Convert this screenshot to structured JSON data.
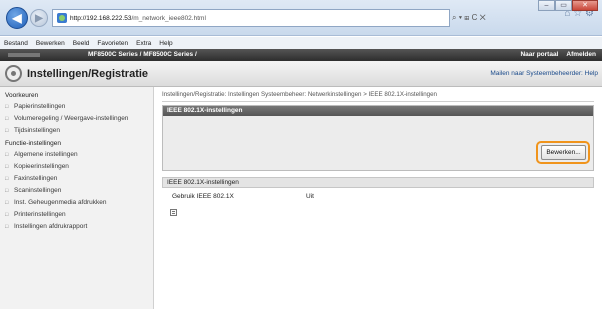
{
  "browser": {
    "url_host": "http://192.168.222.53",
    "url_path": "/m_network_ieee802.html",
    "addr_tools": "⌕ ▾ ⊞ C ✕",
    "right_icons": "⌂ ☆ ⚙",
    "window_buttons": [
      "–",
      "▭",
      "✕"
    ],
    "menu": [
      "Bestand",
      "Bewerken",
      "Beeld",
      "Favorieten",
      "Extra",
      "Help"
    ]
  },
  "device_bar": {
    "name": "MF8500C Series / MF8500C Series /",
    "links": [
      "Naar portaal",
      "Afmelden"
    ]
  },
  "page_header": {
    "title": "Instellingen/Registratie",
    "system_link": "Mailen naar Systeembeheerder: Help"
  },
  "sidebar": {
    "group1": "Voorkeuren",
    "group1_items": [
      "Papierinstellingen",
      "Volumeregeling / Weergave-instellingen",
      "Tijdsinstellingen"
    ],
    "group2": "Functie-instellingen",
    "group2_items": [
      "Algemene instellingen",
      "Kopieerinstellingen",
      "Faxinstellingen",
      "Scaninstellingen",
      "Inst. Geheugenmedia afdrukken",
      "Printerinstellingen",
      "Instellingen afdrukrapport"
    ]
  },
  "main": {
    "breadcrumb": "Instellingen/Registratie: Instellingen Systeembeheer: Netwerkinstellingen > IEEE 802.1X-instellingen",
    "section1_title": "IEEE 802.1X-instellingen",
    "edit_button": "Bewerken...",
    "section2_title": "IEEE 802.1X-instellingen",
    "row_label": "Gebruik IEEE 802.1X",
    "row_value": "Uit"
  },
  "colors": {
    "highlight_ring": "#f0941c",
    "dark_bar": "#2d2d2d",
    "link": "#1a4a8a"
  },
  "icons": {
    "back": "back-arrow-icon",
    "forward": "forward-arrow-icon",
    "page": "page-favicon-icon",
    "gear": "gear-icon",
    "doc": "document-icon"
  }
}
